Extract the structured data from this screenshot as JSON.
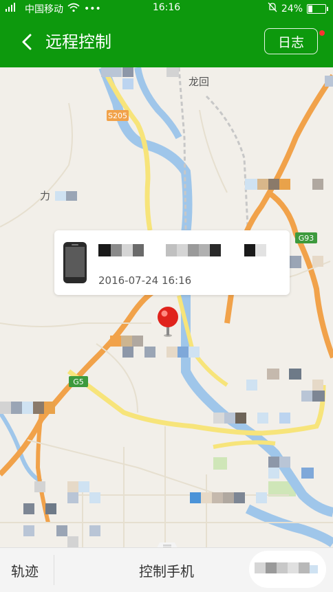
{
  "status_bar": {
    "carrier": "中国移动",
    "time": "16:16",
    "battery": "24%",
    "battery_level": 0.24
  },
  "app_bar": {
    "title": "远程控制",
    "log_button": "日志"
  },
  "map": {
    "road_labels": [
      "S205",
      "G93",
      "G5"
    ],
    "place_labels": [
      "龙回",
      "力"
    ]
  },
  "popup": {
    "timestamp": "2016-07-24 16:16"
  },
  "bottom_bar": {
    "track_label": "轨迹",
    "control_label": "控制手机"
  },
  "colors": {
    "primary_green": "#0d990d",
    "highway_orange": "#f1a24a",
    "road_yellow": "#f7e47a",
    "water_blue": "#9fc6ea",
    "pin_red": "#e0231c"
  }
}
